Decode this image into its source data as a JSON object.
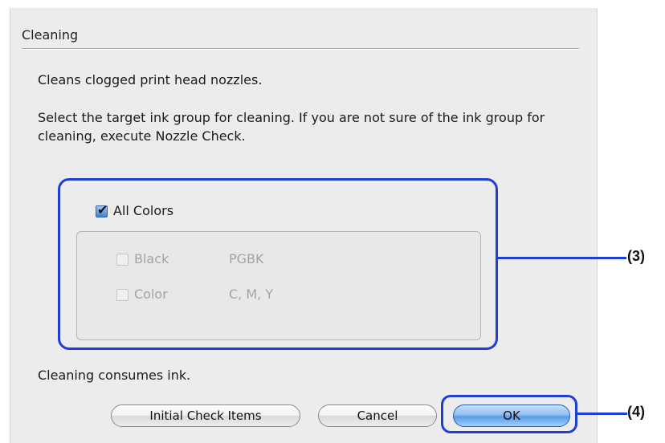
{
  "dialog": {
    "title": "Cleaning",
    "description": "Cleans clogged print head nozzles.",
    "instruction": "Select the target ink group for cleaning. If you are not sure of the ink group for cleaning, execute Nozzle Check.",
    "note": "Cleaning consumes ink."
  },
  "ink_groups": {
    "all_colors": {
      "label": "All Colors",
      "checked": true
    },
    "items": [
      {
        "label": "Black",
        "inks": "PGBK",
        "checked": false,
        "enabled": false
      },
      {
        "label": "Color",
        "inks": "C, M, Y",
        "checked": false,
        "enabled": false
      }
    ]
  },
  "buttons": {
    "initial_check": "Initial Check Items",
    "cancel": "Cancel",
    "ok": "OK"
  },
  "callouts": {
    "group_label": "(3)",
    "ok_label": "(4)"
  },
  "colors": {
    "callout": "#1e3fd4",
    "dialog_bg": "#ececec"
  }
}
